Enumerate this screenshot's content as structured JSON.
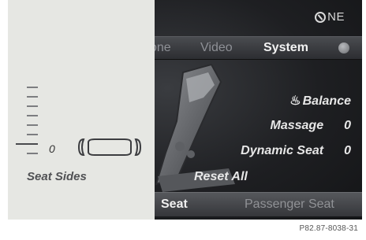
{
  "status": {
    "compass_text": "NE",
    "compass_icon": "compass-icon"
  },
  "menu": {
    "items": [
      {
        "label": "one",
        "active": false
      },
      {
        "label": "Video",
        "active": false
      },
      {
        "label": "System",
        "active": true
      }
    ]
  },
  "options": {
    "balance_label": "Balance",
    "massage_label": "Massage",
    "massage_value": "0",
    "dynamic_seat_label": "Dynamic Seat",
    "dynamic_seat_value": "0",
    "reset_all_label": "Reset All"
  },
  "bottom_bar": {
    "seat_label": "Seat",
    "passenger_seat_label": "Passenger Seat"
  },
  "panel": {
    "value": "0",
    "label": "Seat Sides"
  },
  "caption": "P82.87-8038-31",
  "colors": {
    "screen_bg": "#17181b",
    "panel_bg": "#e6e7e3",
    "text_active": "#f2f2f2",
    "text_inactive": "#8e9096"
  }
}
